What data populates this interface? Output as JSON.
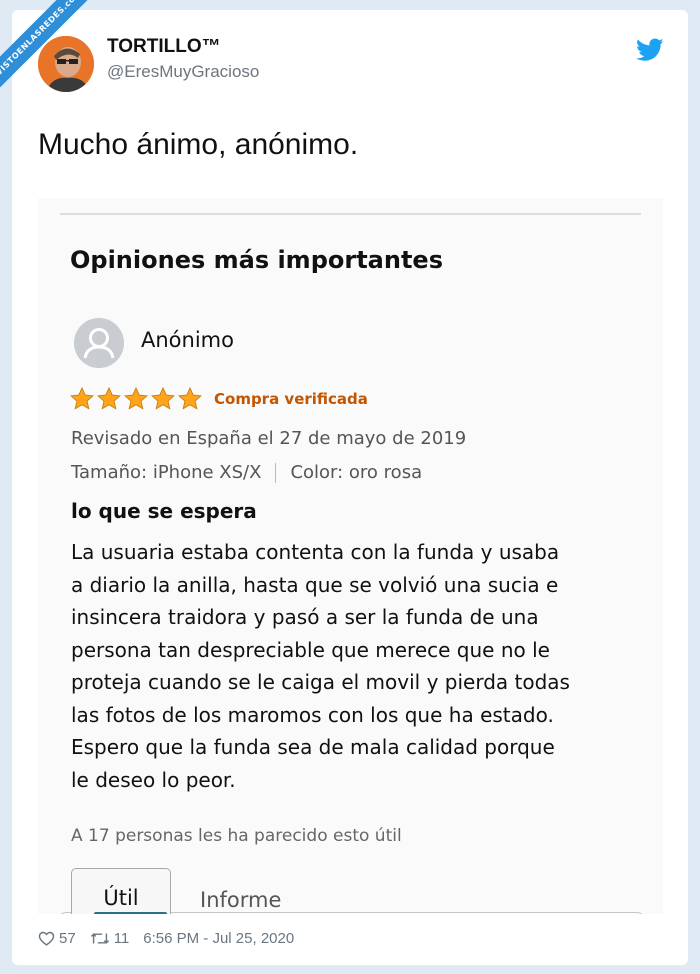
{
  "watermark": {
    "text": "VISTOENLASREDES",
    "sub": ".com"
  },
  "tweet": {
    "display_name": "TORTILLO™",
    "handle": "@EresMuyGracioso",
    "text": "Mucho ánimo, anónimo.",
    "likes": "57",
    "retweets": "11",
    "timestamp": "6:56 PM - Jul 25, 2020"
  },
  "review": {
    "section_title": "Opiniones más importantes",
    "reviewer": "Anónimo",
    "rating": 5,
    "verified_label": "Compra verificada",
    "date_text": "Revisado en España el 27 de mayo de 2019",
    "size_text": "Tamaño: iPhone XS/X",
    "color_text": "Color: oro rosa",
    "title": "lo que se espera",
    "body_lines": [
      "La usuaria estaba contenta con la funda y usaba",
      "a diario la anilla, hasta que se volvió una sucia e",
      "insincera traidora y pasó a ser la funda de una",
      "persona tan despreciable que merece que no le",
      "proteja cuando se le caiga el movil y pierda todas",
      "las fotos de los maromos con los que ha estado.",
      "Espero que la funda sea de mala calidad porque",
      "le deseo lo peor."
    ],
    "helpful_text": "A 17 personas les ha parecido esto útil",
    "helpful_button": "Útil",
    "report_link": "Informe"
  },
  "colors": {
    "twitter_blue": "#1da1f2",
    "star": "#ffa41c",
    "verified": "#c45500"
  }
}
